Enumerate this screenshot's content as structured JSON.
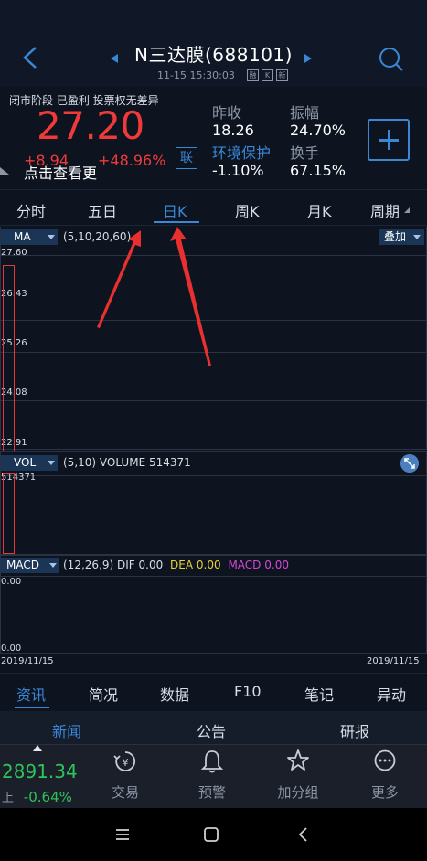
{
  "header": {
    "title": "N三达膜(688101)",
    "subtitle": "11-15 15:30:03",
    "tags": [
      "融",
      "K",
      "新"
    ]
  },
  "quote": {
    "status": "闭市阶段  已盈利  投票权无差异",
    "price": "27.20",
    "change": "+8.94",
    "change_pct": "+48.96%",
    "tip": "点击查看更",
    "lian": "联",
    "stats": [
      {
        "label": "昨收",
        "value": "18.26"
      },
      {
        "label": "振幅",
        "value": "24.70%"
      },
      {
        "label": "环境保护",
        "value": "-1.10%"
      },
      {
        "label": "换手",
        "value": "67.15%"
      }
    ]
  },
  "period_tabs": [
    "分时",
    "五日",
    "日K",
    "周K",
    "月K",
    "周期"
  ],
  "ma_panel": {
    "selector": "MA",
    "params": "(5,10,20,60)",
    "overlay": "叠加",
    "axis": [
      "27.60",
      "26.43",
      "25.26",
      "24.08",
      "22.91"
    ]
  },
  "vol_panel": {
    "selector": "VOL",
    "params": "(5,10) VOLUME  514371",
    "axis_top": "514371"
  },
  "macd_panel": {
    "selector": "MACD",
    "params": "(12,26,9) DIF",
    "dif": "0.00",
    "dea_label": "DEA",
    "dea": "0.00",
    "macd_label": "MACD",
    "macd": "0.00",
    "axis_top": "0.00",
    "axis_bottom": "0.00",
    "date_left": "2019/11/15",
    "date_right": "2019/11/15"
  },
  "info_tabs": [
    "资讯",
    "简况",
    "数据",
    "F10",
    "笔记",
    "异动"
  ],
  "sub_tabs": [
    "新闻",
    "公告",
    "研报"
  ],
  "footer": {
    "index_value": "2891.34",
    "index_prefix": "上",
    "index_pct": "-0.64%",
    "nav": [
      "交易",
      "预警",
      "加分组",
      "更多"
    ]
  },
  "colors": {
    "up": "#f03a3a",
    "down": "#2ec45a",
    "accent": "#3a87d6",
    "dea": "#e8d23a",
    "macd": "#d548d5"
  }
}
